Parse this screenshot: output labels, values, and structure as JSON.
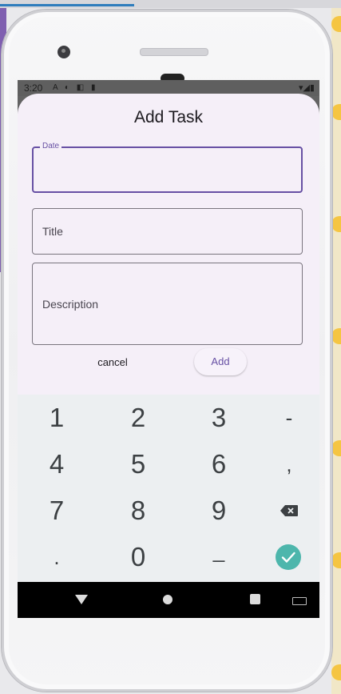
{
  "status_bar": {
    "time": "3:20",
    "indicators": "A ◐ ◧ ▮",
    "right_icons": "▾◢▮"
  },
  "dialog": {
    "title": "Add Task",
    "date_field": {
      "floating_label": "Date",
      "value": ""
    },
    "title_field": {
      "label": "Title",
      "value": ""
    },
    "description_field": {
      "label": "Description",
      "value": ""
    },
    "cancel_label": "cancel",
    "add_label": "Add"
  },
  "keypad": {
    "keys": [
      "1",
      "2",
      "3",
      "-",
      "4",
      "5",
      "6",
      ",",
      "7",
      "8",
      "9",
      ".",
      "0",
      "_"
    ],
    "backspace_icon": "backspace-icon",
    "done_icon": "check-icon",
    "done_color": "#4db6ac"
  },
  "navigation": {
    "back_icon": "back-icon",
    "home_icon": "home-icon",
    "recent_icon": "recents-icon",
    "keyboard_icon": "keyboard-icon"
  },
  "colors": {
    "primary": "#6750a4",
    "dialog_bg": "#f5eff8",
    "keypad_bg": "#eceff1"
  }
}
